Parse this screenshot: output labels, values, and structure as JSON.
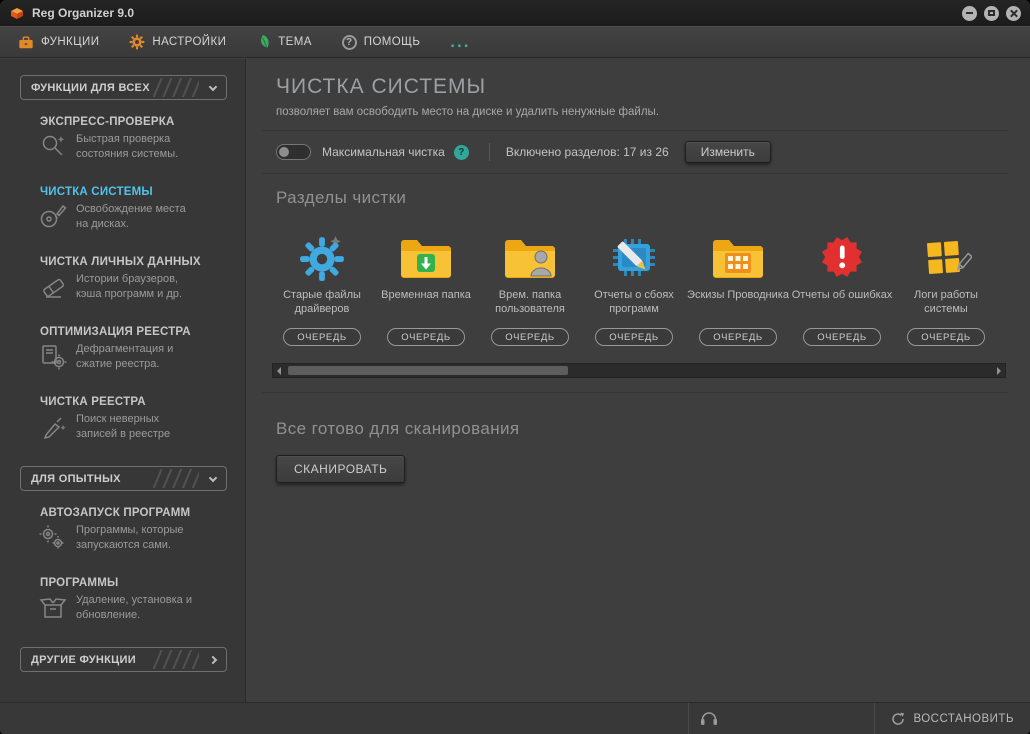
{
  "window": {
    "title": "Reg Organizer 9.0"
  },
  "menu": {
    "functions": "ФУНКЦИИ",
    "settings": "НАСТРОЙКИ",
    "theme": "ТЕМА",
    "help": "ПОМОЩЬ",
    "more": "..."
  },
  "glyphs": {
    "question": "?"
  },
  "sidebar": {
    "groups": [
      {
        "header": "ФУНКЦИИ ДЛЯ ВСЕХ",
        "items": [
          {
            "title": "ЭКСПРЕСС-ПРОВЕРКА",
            "desc": "Быстрая проверка состояния системы."
          },
          {
            "title": "ЧИСТКА СИСТЕМЫ",
            "desc": "Освобождение места на дисках."
          },
          {
            "title": "ЧИСТКА ЛИЧНЫХ ДАННЫХ",
            "desc": "Истории браузеров, кэша программ и др."
          },
          {
            "title": "ОПТИМИЗАЦИЯ РЕЕСТРА",
            "desc": "Дефрагментация и сжатие реестра."
          },
          {
            "title": "ЧИСТКА РЕЕСТРА",
            "desc": "Поиск неверных записей в реестре"
          }
        ]
      },
      {
        "header": "ДЛЯ ОПЫТНЫХ",
        "items": [
          {
            "title": "АВТОЗАПУСК ПРОГРАММ",
            "desc": "Программы, которые запускаются сами."
          },
          {
            "title": "ПРОГРАММЫ",
            "desc": "Удаление, установка и обновление."
          }
        ]
      },
      {
        "header": "ДРУГИЕ ФУНКЦИИ",
        "items": []
      }
    ]
  },
  "main": {
    "title": "ЧИСТКА СИСТЕМЫ",
    "subtitle": "позволяет вам освободить место на диске и удалить ненужные файлы.",
    "max_clean_label": "Максимальная чистка",
    "enabled_sections": "Включено разделов: 17 из 26",
    "change_button": "Изменить",
    "sections_heading": "Разделы чистки",
    "queue_button": "ОЧЕРЕДЬ",
    "cards": [
      {
        "label": "Старые файлы драйверов",
        "icon": "driver-gear-icon"
      },
      {
        "label": "Временная папка",
        "icon": "folder-download-icon"
      },
      {
        "label": "Врем. папка пользователя",
        "icon": "folder-user-icon"
      },
      {
        "label": "Отчеты о сбоях программ",
        "icon": "chip-pencil-icon"
      },
      {
        "label": "Эскизы Проводника",
        "icon": "folder-thumbnails-icon"
      },
      {
        "label": "Отчеты об ошибках",
        "icon": "error-burst-icon"
      },
      {
        "label": "Логи работы системы",
        "icon": "windows-logs-icon"
      }
    ],
    "ready_heading": "Все готово для сканирования",
    "scan_button": "СКАНИРОВАТЬ"
  },
  "statusbar": {
    "restore_button": "ВОССТАНОВИТЬ"
  },
  "colors": {
    "accent_blue": "#2f9fd0",
    "selected_cyan": "#4fc3ea",
    "folder_yellow": "#f3b517",
    "alert_red": "#e23030",
    "menu_orange": "#e0892a",
    "teal": "#2fa89a",
    "background": "#3e3e3e"
  }
}
